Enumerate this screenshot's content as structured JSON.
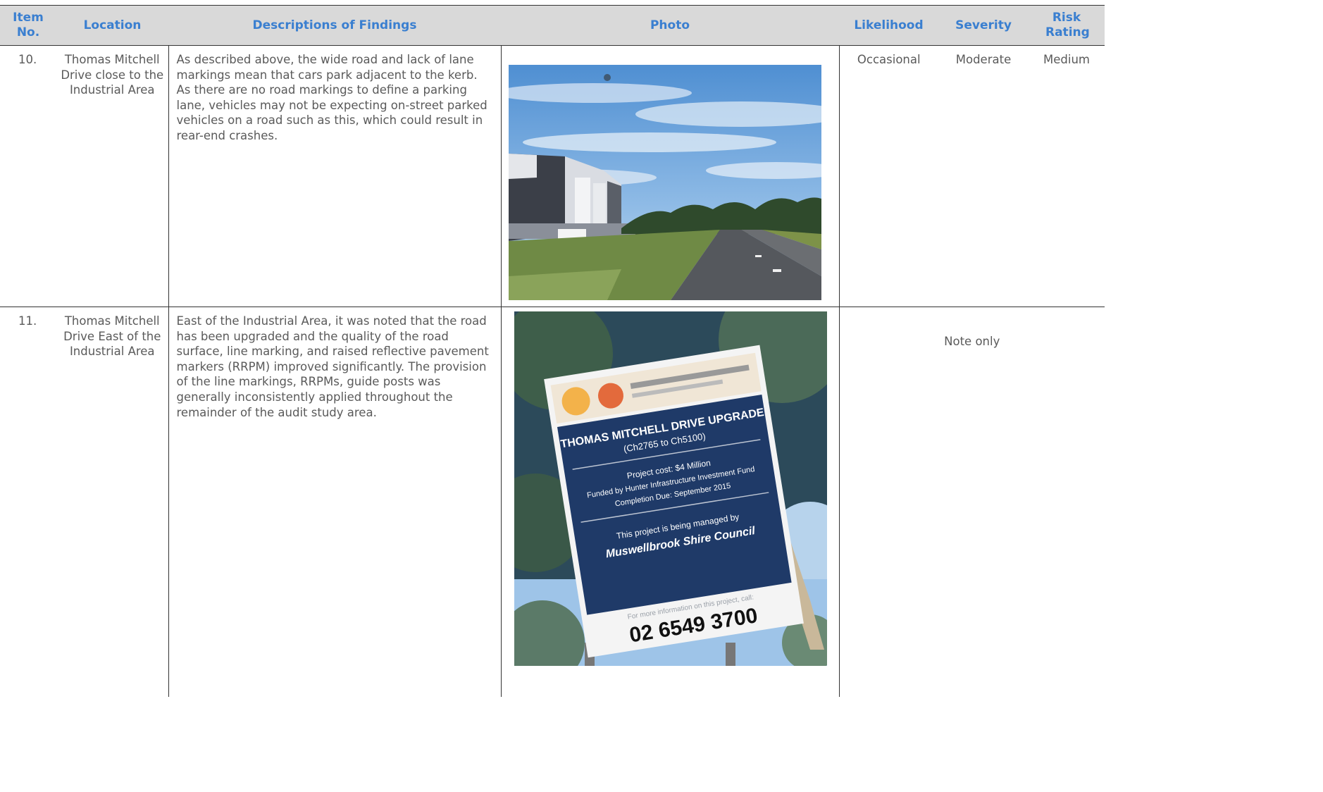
{
  "table": {
    "headers": {
      "item": "Item No.",
      "location": "Location",
      "description": "Descriptions of Findings",
      "photo": "Photo",
      "likelihood": "Likelihood",
      "severity": "Severity",
      "risk": "Risk Rating"
    },
    "rows": [
      {
        "item": "10.",
        "location": "Thomas Mitchell Drive close to the Industrial Area",
        "description": "As described above, the wide road and lack of lane markings mean that cars park adjacent to the kerb. As there are no road markings to define a parking lane, vehicles may not be expecting on-street parked vehicles on a road such as this, which could result in rear-end crashes.",
        "photo_name": "industrial-road-photo",
        "likelihood": "Occasional",
        "severity": "Moderate",
        "risk": "Medium"
      },
      {
        "item": "11.",
        "location": "Thomas Mitchell Drive East of the Industrial Area",
        "description": "East of the Industrial Area, it was noted that the road has been upgraded and the quality of the road surface, line marking, and raised reflective pavement markers (RRPM) improved significantly. The provision of the line markings, RRPMs, guide posts was generally inconsistently applied throughout the remainder of the audit study area.",
        "photo_name": "upgrade-sign-photo",
        "note": "Note only",
        "sign": {
          "title": "THOMAS MITCHELL DRIVE UPGRADE",
          "chainage": "(Ch2765 to Ch5100)",
          "cost": "Project cost: $4 Million",
          "funded": "Funded by Hunter Infrastructure Investment Fund",
          "completion": "Completion Due: September 2015",
          "managed": "This project is being managed by",
          "council": "Muswellbrook Shire Council",
          "info": "For more information on this project, call:",
          "phone": "02 6549 3700"
        }
      }
    ]
  },
  "colors": {
    "header_bg": "#d9d9d9",
    "header_text": "#3a7fd0",
    "body_text": "#5a5a5a",
    "sign_blue": "#1f3a68"
  }
}
